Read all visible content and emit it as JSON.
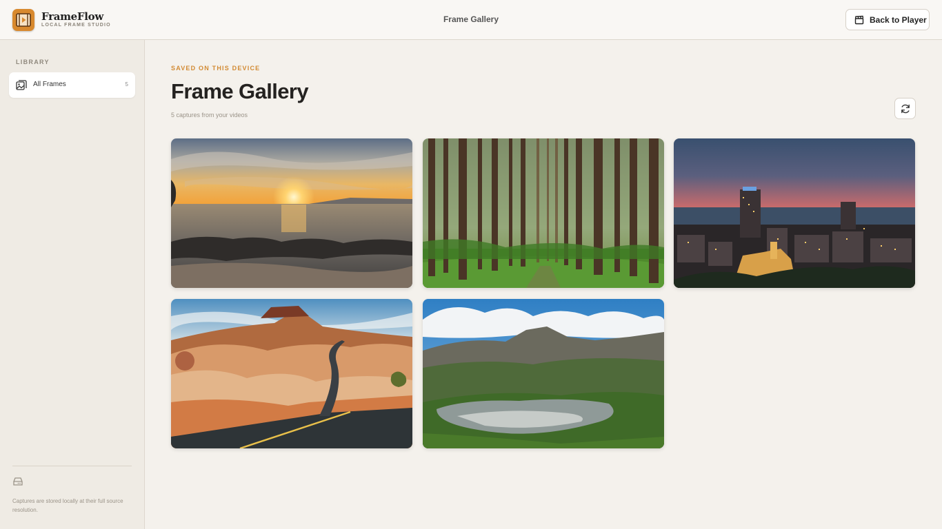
{
  "app": {
    "name": "FrameFlow",
    "tagline": "LOCAL FRAME STUDIO",
    "logo_icon": "film-play-icon",
    "accent_color": "#d8892e"
  },
  "header": {
    "title": "Frame Gallery",
    "back_button": {
      "label": "Back to Player",
      "icon": "clapperboard-icon"
    }
  },
  "sidebar": {
    "heading": "LIBRARY",
    "items": [
      {
        "label": "All Frames",
        "count": "5",
        "icon": "gallery-icon",
        "active": true
      }
    ],
    "footer": {
      "icon": "hard-drive-icon",
      "note": "Captures are stored locally at their full source resolution."
    }
  },
  "main": {
    "eyebrow": "SAVED ON THIS DEVICE",
    "title": "Frame Gallery",
    "subtitle": "5 captures from your videos",
    "refresh_icon": "refresh-icon",
    "frames": [
      {
        "subject": "ocean-sunset"
      },
      {
        "subject": "pine-forest"
      },
      {
        "subject": "city-dusk"
      },
      {
        "subject": "desert-road"
      },
      {
        "subject": "mountain-lake"
      }
    ]
  }
}
